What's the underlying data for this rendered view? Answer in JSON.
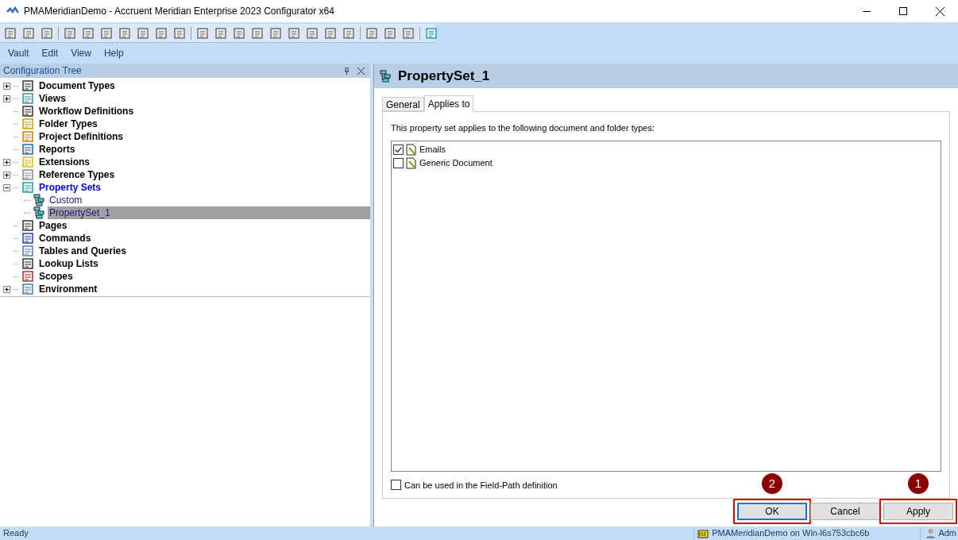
{
  "window": {
    "title": "PMAMeridianDemo - Accruent Meridian Enterprise 2023 Configurator x64"
  },
  "menu": [
    "Vault",
    "Edit",
    "View",
    "Help"
  ],
  "tree_panel": {
    "title": "Configuration Tree",
    "items": [
      {
        "label": "Document Types",
        "kind": "expandable",
        "expanded": false,
        "active": false,
        "selected": false
      },
      {
        "label": "Views",
        "kind": "expandable",
        "expanded": false,
        "active": false,
        "selected": false
      },
      {
        "label": "Workflow Definitions",
        "kind": "leaf",
        "active": false,
        "selected": false
      },
      {
        "label": "Folder Types",
        "kind": "leaf",
        "active": false,
        "selected": false
      },
      {
        "label": "Project Definitions",
        "kind": "leaf",
        "active": false,
        "selected": false
      },
      {
        "label": "Reports",
        "kind": "leaf",
        "active": false,
        "selected": false
      },
      {
        "label": "Extensions",
        "kind": "expandable",
        "expanded": false,
        "active": false,
        "selected": false
      },
      {
        "label": "Reference Types",
        "kind": "expandable",
        "expanded": false,
        "active": false,
        "selected": false
      },
      {
        "label": "Property Sets",
        "kind": "expandable",
        "expanded": true,
        "active": true,
        "selected": false,
        "children": [
          {
            "label": "Custom",
            "selected": false
          },
          {
            "label": "PropertySet_1",
            "selected": true
          }
        ]
      },
      {
        "label": "Pages",
        "kind": "leaf",
        "active": false,
        "selected": false
      },
      {
        "label": "Commands",
        "kind": "leaf",
        "active": false,
        "selected": false
      },
      {
        "label": "Tables and Queries",
        "kind": "leaf",
        "active": false,
        "selected": false
      },
      {
        "label": "Lookup Lists",
        "kind": "leaf",
        "active": false,
        "selected": false
      },
      {
        "label": "Scopes",
        "kind": "leaf",
        "active": false,
        "selected": false
      },
      {
        "label": "Environment",
        "kind": "expandable",
        "expanded": false,
        "active": false,
        "selected": false
      }
    ]
  },
  "detail": {
    "title": "PropertySet_1",
    "tabs": [
      {
        "label": "General",
        "selected": false
      },
      {
        "label": "Applies to",
        "selected": true
      }
    ],
    "description": "This property set applies to the following document and folder types:",
    "types": [
      {
        "label": "Emails",
        "checked": true
      },
      {
        "label": "Generic Document",
        "checked": false
      }
    ],
    "field_path_option": {
      "label": "Can be used in the Field-Path definition",
      "checked": false
    },
    "buttons": [
      {
        "label": "OK",
        "focused": true,
        "marker": "2"
      },
      {
        "label": "Cancel",
        "focused": false
      },
      {
        "label": "Apply",
        "focused": false,
        "marker": "1"
      }
    ]
  },
  "status_bar": {
    "state": "Ready",
    "connection": "PMAMeridianDemo on Win-l6s753cbc6b",
    "user": "Adm"
  }
}
